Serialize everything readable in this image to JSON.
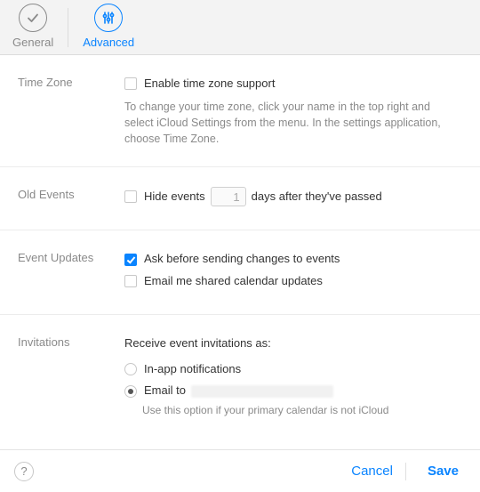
{
  "tabs": {
    "general": "General",
    "advanced": "Advanced"
  },
  "timezone": {
    "label": "Time Zone",
    "checkbox": "Enable time zone support",
    "help": "To change your time zone, click your name in the top right and select iCloud Settings from the menu. In the settings application, choose Time Zone."
  },
  "oldevents": {
    "label": "Old Events",
    "prefix": "Hide events",
    "days": "1",
    "suffix": "days after they've passed"
  },
  "updates": {
    "label": "Event Updates",
    "ask": "Ask before sending changes to events",
    "email": "Email me shared calendar updates"
  },
  "invitations": {
    "label": "Invitations",
    "heading": "Receive event invitations as:",
    "inapp": "In-app notifications",
    "emailto": "Email to",
    "help": "Use this option if your primary calendar is not iCloud"
  },
  "footer": {
    "help": "?",
    "cancel": "Cancel",
    "save": "Save"
  }
}
